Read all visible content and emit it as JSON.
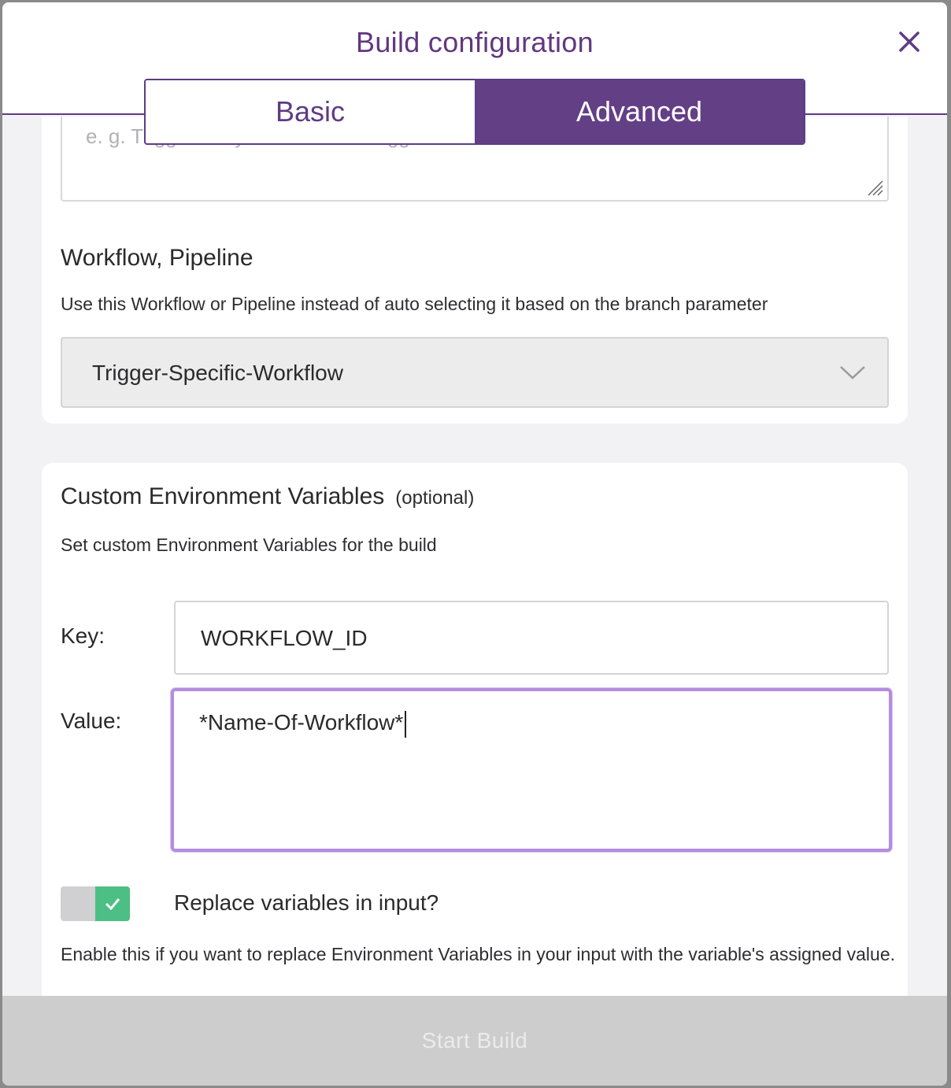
{
  "modal": {
    "title": "Build configuration",
    "close_icon": "close-icon"
  },
  "tabs": [
    {
      "label": "Basic",
      "active": false
    },
    {
      "label": "Advanced",
      "active": true
    }
  ],
  "message_field": {
    "placeholder": "e. g. Triggered by Bitrise Build Trigger URL"
  },
  "workflow": {
    "title": "Workflow, Pipeline",
    "description": "Use this Workflow or Pipeline instead of auto selecting it based on the branch parameter",
    "selected": "Trigger-Specific-Workflow",
    "icon": "chevron-down-icon"
  },
  "env_vars": {
    "title": "Custom Environment Variables",
    "optional": "(optional)",
    "description": "Set custom Environment Variables for the build",
    "key_label": "Key:",
    "key_value": "WORKFLOW_ID",
    "value_label": "Value:",
    "value_value": "*Name-Of-Workflow*",
    "replace_label": "Replace variables in input?",
    "replace_enabled": true,
    "replace_help": "Enable this if you want to replace Environment Variables in your input with the variable's assigned value."
  },
  "footer": {
    "start_label": "Start Build"
  },
  "colors": {
    "brand": "#633f86",
    "focus": "#b48ce0",
    "toggle_on": "#4cbf84"
  }
}
